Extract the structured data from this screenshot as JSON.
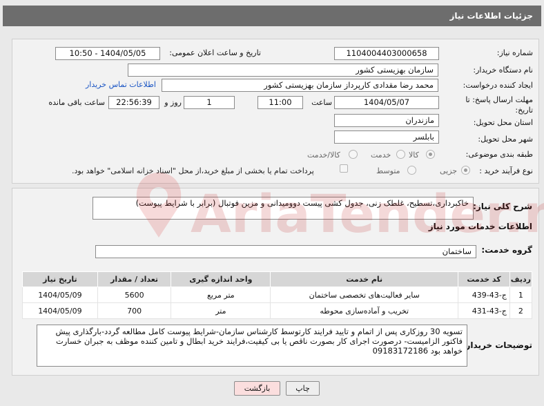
{
  "header": {
    "title": "جزئیات اطلاعات نیاز"
  },
  "form": {
    "need_number_label": "شماره نیاز:",
    "need_number": "1104004403000658",
    "announce_label": "تاریخ و ساعت اعلان عمومی:",
    "announce_value": "1404/05/05 - 10:50",
    "buyer_org_label": "نام دستگاه خریدار:",
    "buyer_org": "سازمان بهزیستی کشور",
    "requester_label": "ایجاد کننده درخواست:",
    "requester": "محمد رضا  مقدادی کارپرداز سازمان بهزیستی کشور",
    "contact_link": "اطلاعات تماس خریدار",
    "deadline_label": "مهلت ارسال پاسخ: تا تاریخ:",
    "deadline_date": "1404/05/07",
    "time_label": "ساعت",
    "deadline_time": "11:00",
    "days_value": "1",
    "days_label": "روز و",
    "remaining_time": "22:56:39",
    "remaining_label": "ساعت باقی مانده",
    "province_label": "استان محل تحویل:",
    "province": "مازندران",
    "city_label": "شهر محل تحویل:",
    "city": "بابلسر",
    "category_label": "طبقه بندی موضوعی:",
    "category_options": [
      "کالا",
      "خدمت",
      "کالا/خدمت"
    ],
    "process_label": "نوع فرآیند خرید :",
    "process_options": [
      "جزیی",
      "متوسط"
    ],
    "payment_note": "پرداخت تمام یا بخشی از مبلغ خرید،از محل \"اسناد خزانه اسلامی\" خواهد بود."
  },
  "description": {
    "label": "شرح کلی نیاز:",
    "text": "خاکبرداری،تسطیح، غلطک زنی، جدول کشی پیست دوومیدانی و مزین فوتبال (برابر با شرایط پیوست)"
  },
  "services": {
    "section_title": "اطلاعات خدمات مورد نیاز",
    "group_label": "گروه خدمت:",
    "group_value": "ساختمان",
    "columns": [
      "ردیف",
      "کد خدمت",
      "نام خدمت",
      "واحد اندازه گیری",
      "تعداد / مقدار",
      "تاریخ نیاز"
    ],
    "rows": [
      {
        "row": "1",
        "code": "ج-43-439",
        "name": "سایر فعالیت‌های تخصصی ساختمان",
        "unit": "متر مربع",
        "qty": "5600",
        "date": "1404/05/09"
      },
      {
        "row": "2",
        "code": "ج-43-431",
        "name": "تخریب و آماده‌سازی محوطه",
        "unit": "متر",
        "qty": "700",
        "date": "1404/05/09"
      }
    ]
  },
  "buyer_notes": {
    "label": "توضیحات خریدار:",
    "text": "تسویه 30 روزکاری پس از اتمام و تایید فرایند کارتوسط کارشناس سازمان-شرایط پیوست کامل مطالعه گردد-بارگذاری پیش فاکتور الزامیست- درصورت اجرای کار بصورت ناقص یا بی کیفیت،فرایند خرید ابطال و تامین کننده موظف به جبران خسارت خواهد بود 09183172186"
  },
  "buttons": {
    "print": "چاپ",
    "back": "بازگشت"
  },
  "watermark": {
    "text": "AriaTender.net"
  }
}
